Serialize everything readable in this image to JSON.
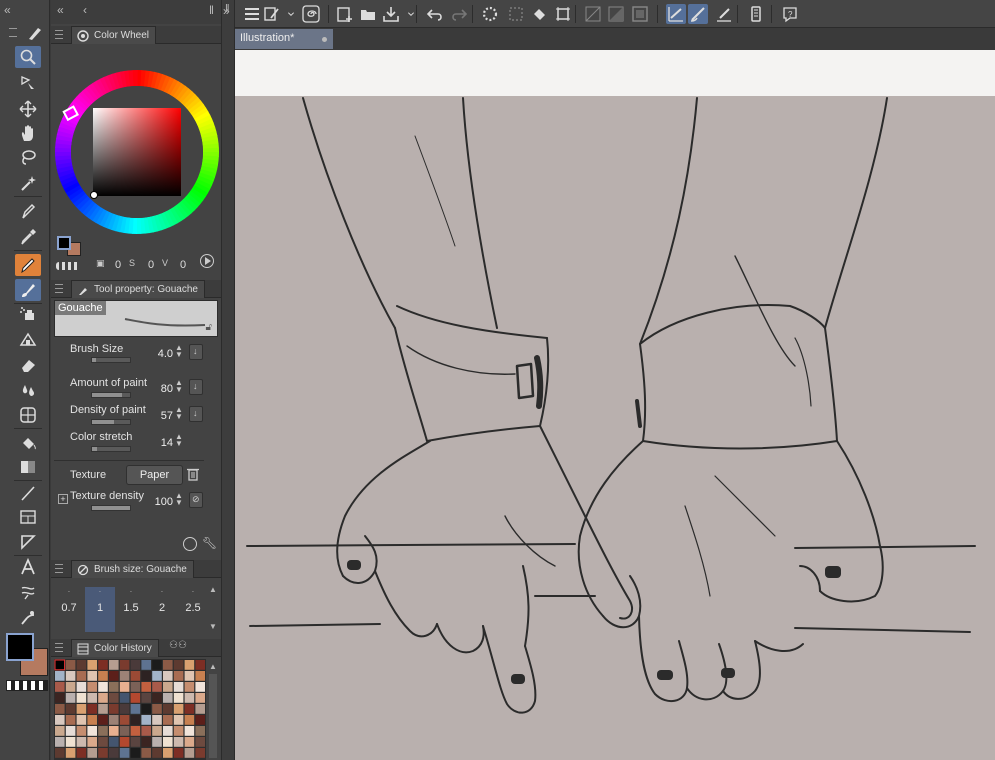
{
  "colors": {
    "accent": "#55709a",
    "hot": "#e0823a",
    "main_color": "#000000",
    "sub_color": "#b57a60",
    "paper": "#b9b0ae"
  },
  "toolbar": {
    "tools": [
      {
        "name": "zoom-tool",
        "icon": "magnifier-icon",
        "selected": true
      },
      {
        "name": "operation-tool",
        "icon": "object-select-icon"
      },
      {
        "name": "move-layer-tool",
        "icon": "move-arrows-icon"
      },
      {
        "name": "hand-tool",
        "icon": "hand-icon"
      },
      {
        "name": "lasso-tool",
        "icon": "lasso-icon"
      },
      {
        "name": "auto-select-tool",
        "icon": "magic-wand-icon"
      },
      {
        "name": "pen-tool",
        "icon": "pen-nib-icon"
      },
      {
        "name": "eyedropper-tool",
        "icon": "eyedropper-icon"
      },
      {
        "name": "pencil-tool",
        "icon": "pencil-icon",
        "hot": true
      },
      {
        "name": "brush-tool",
        "icon": "brush-icon",
        "selected": true
      },
      {
        "name": "airbrush-tool",
        "icon": "airbrush-icon"
      },
      {
        "name": "decoration-tool",
        "icon": "decoration-icon"
      },
      {
        "name": "eraser-tool",
        "icon": "eraser-icon"
      },
      {
        "name": "blend-tool",
        "icon": "blend-drops-icon"
      },
      {
        "name": "fill-tool",
        "icon": "fill-grid-icon"
      },
      {
        "name": "bucket-tool",
        "icon": "paint-bucket-icon"
      },
      {
        "name": "gradient-tool",
        "icon": "gradient-icon"
      },
      {
        "name": "figure-tool",
        "icon": "line-icon"
      },
      {
        "name": "frame-tool",
        "icon": "frame-border-icon"
      },
      {
        "name": "ruler-tool",
        "icon": "ruler-icon"
      },
      {
        "name": "text-tool",
        "icon": "text-a-icon"
      },
      {
        "name": "balloon-tool",
        "icon": "balloon-icon"
      },
      {
        "name": "correct-line-tool",
        "icon": "correct-line-icon"
      }
    ]
  },
  "color_wheel": {
    "tab_label": "Color Wheel",
    "h_value": "0",
    "s_value": "0",
    "v_value": "0"
  },
  "tool_property": {
    "tab_label": "Tool property: Gouache",
    "brush_name": "Gouache",
    "brush_size_label": "Brush Size",
    "brush_size_value": "4.0",
    "brush_size_level": 0.1,
    "amount_label": "Amount of paint",
    "amount_value": "80",
    "amount_level": 0.8,
    "density_label": "Density of paint",
    "density_value": "57",
    "density_level": 0.57,
    "stretch_label": "Color stretch",
    "stretch_value": "14",
    "stretch_level": 0.14,
    "texture_label": "Texture",
    "texture_value": "Paper",
    "texture_density_label": "Texture density",
    "texture_density_value": "100",
    "texture_density_level": 1.0
  },
  "brush_size": {
    "tab_label": "Brush size: Gouache",
    "sizes": [
      "0.7",
      "1",
      "1.5",
      "2",
      "2.5"
    ],
    "selected_index": 1
  },
  "color_history": {
    "tab_label": "Color History"
  },
  "document": {
    "tab_label": "Illustration*"
  }
}
